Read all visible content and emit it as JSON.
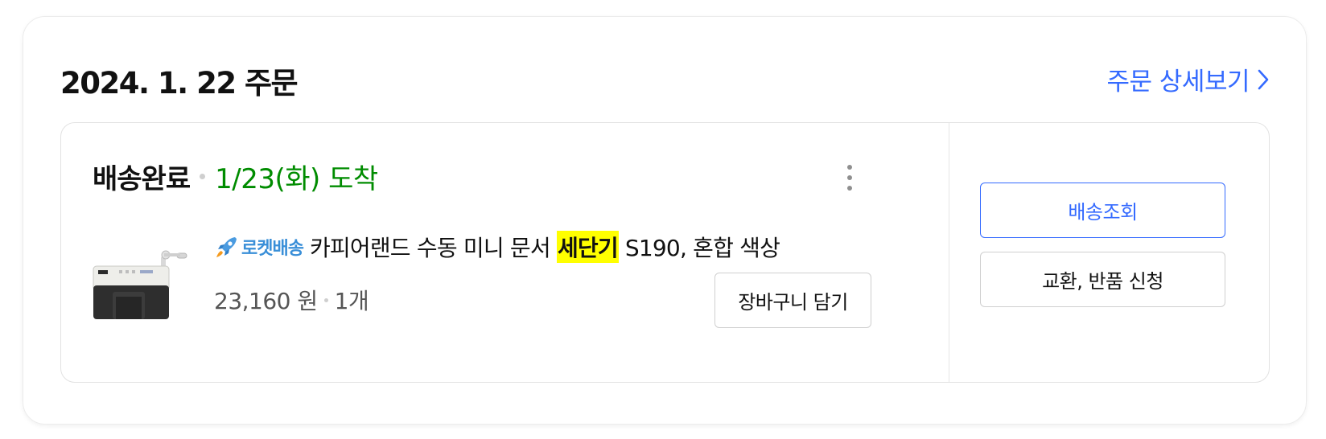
{
  "order": {
    "date_title": "2024. 1. 22 주문",
    "detail_link_label": "주문 상세보기"
  },
  "shipment": {
    "status": "배송완료",
    "arrival": "1/23(화) 도착"
  },
  "product": {
    "delivery_badge_icon": "rocket-icon",
    "delivery_badge_label": "로켓배송",
    "name_prefix": "카피어랜드 수동 미니 문서 ",
    "name_highlight": "세단기",
    "name_suffix": " S190, 혼합 색상",
    "price": "23,160 원",
    "quantity": "1개",
    "thumbnail_icon": "paper-shredder-image"
  },
  "actions": {
    "add_to_cart": "장바구니 담기",
    "track_delivery": "배송조회",
    "exchange_return": "교환, 반품 신청",
    "more_menu_icon": "more-vertical-icon"
  },
  "colors": {
    "accent": "#346aff",
    "arrival_green": "#008c00",
    "highlight": "#ffff00",
    "rocket_blue": "#3a8fd8"
  }
}
